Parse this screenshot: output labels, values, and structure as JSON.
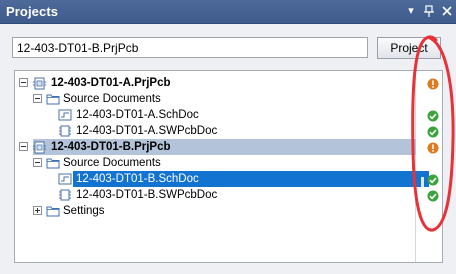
{
  "panel": {
    "title": "Projects",
    "dropdown_glyph": "▾",
    "pin_glyph": "⊥",
    "close_glyph": "✕"
  },
  "search": {
    "value": "12-403-DT01-B.PrjPcb",
    "button_label": "Project"
  },
  "tree": {
    "rows": [
      {
        "label": "12-403-DT01-A.PrjPcb",
        "icon": "pcb-project-icon",
        "status": "warning-icon"
      },
      {
        "label": "Source Documents",
        "icon": "folder-icon"
      },
      {
        "label": "12-403-DT01-A.SchDoc",
        "icon": "schematic-doc-icon",
        "status": "ok-check-icon"
      },
      {
        "label": "12-403-DT01-A.SWPcbDoc",
        "icon": "pcb-doc-icon",
        "status": "ok-check-icon"
      },
      {
        "label": "12-403-DT01-B.PrjPcb",
        "icon": "pcb-project-icon",
        "status": "warning-icon"
      },
      {
        "label": "Source Documents",
        "icon": "folder-icon"
      },
      {
        "label": "12-403-DT01-B.SchDoc",
        "icon": "schematic-doc-icon",
        "status": "ok-check-icon"
      },
      {
        "label": "12-403-DT01-B.SWPcbDoc",
        "icon": "pcb-doc-icon",
        "status": "ok-check-icon"
      },
      {
        "label": "Settings",
        "icon": "folder-icon"
      }
    ]
  },
  "colors": {
    "titlebar": "#4d6a9b",
    "selection_blue": "#1273d0",
    "selection_gray": "#b3c3d9",
    "ok_green": "#3aa33a",
    "warning_orange": "#e07a1f",
    "annotation_red": "#e8323a"
  }
}
